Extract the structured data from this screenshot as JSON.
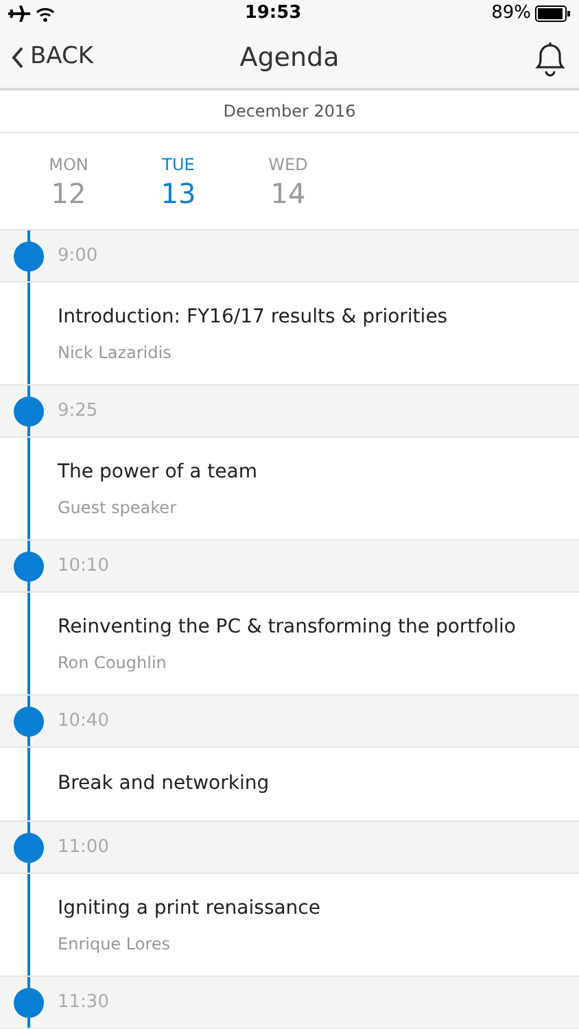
{
  "status_bar": {
    "time": "19:53",
    "battery": "89%"
  },
  "nav": {
    "back": "BACK",
    "title": "Agenda"
  },
  "month": "December 2016",
  "days": [
    {
      "weekday": "MON",
      "date": "12",
      "selected": false
    },
    {
      "weekday": "TUE",
      "date": "13",
      "selected": true
    },
    {
      "weekday": "WED",
      "date": "14",
      "selected": false
    }
  ],
  "slots": [
    {
      "time": "9:00",
      "title": "Introduction: FY16/17 results & priorities",
      "speaker": "Nick Lazaridis"
    },
    {
      "time": "9:25",
      "title": "The power of a team",
      "speaker": "Guest speaker"
    },
    {
      "time": "10:10",
      "title": "Reinventing the PC & transforming the portfolio",
      "speaker": "Ron Coughlin"
    },
    {
      "time": "10:40",
      "title": "Break and networking"
    },
    {
      "time": "11:00",
      "title": "Igniting a print renaissance",
      "speaker": "Enrique Lores"
    },
    {
      "time": "11:30"
    }
  ]
}
